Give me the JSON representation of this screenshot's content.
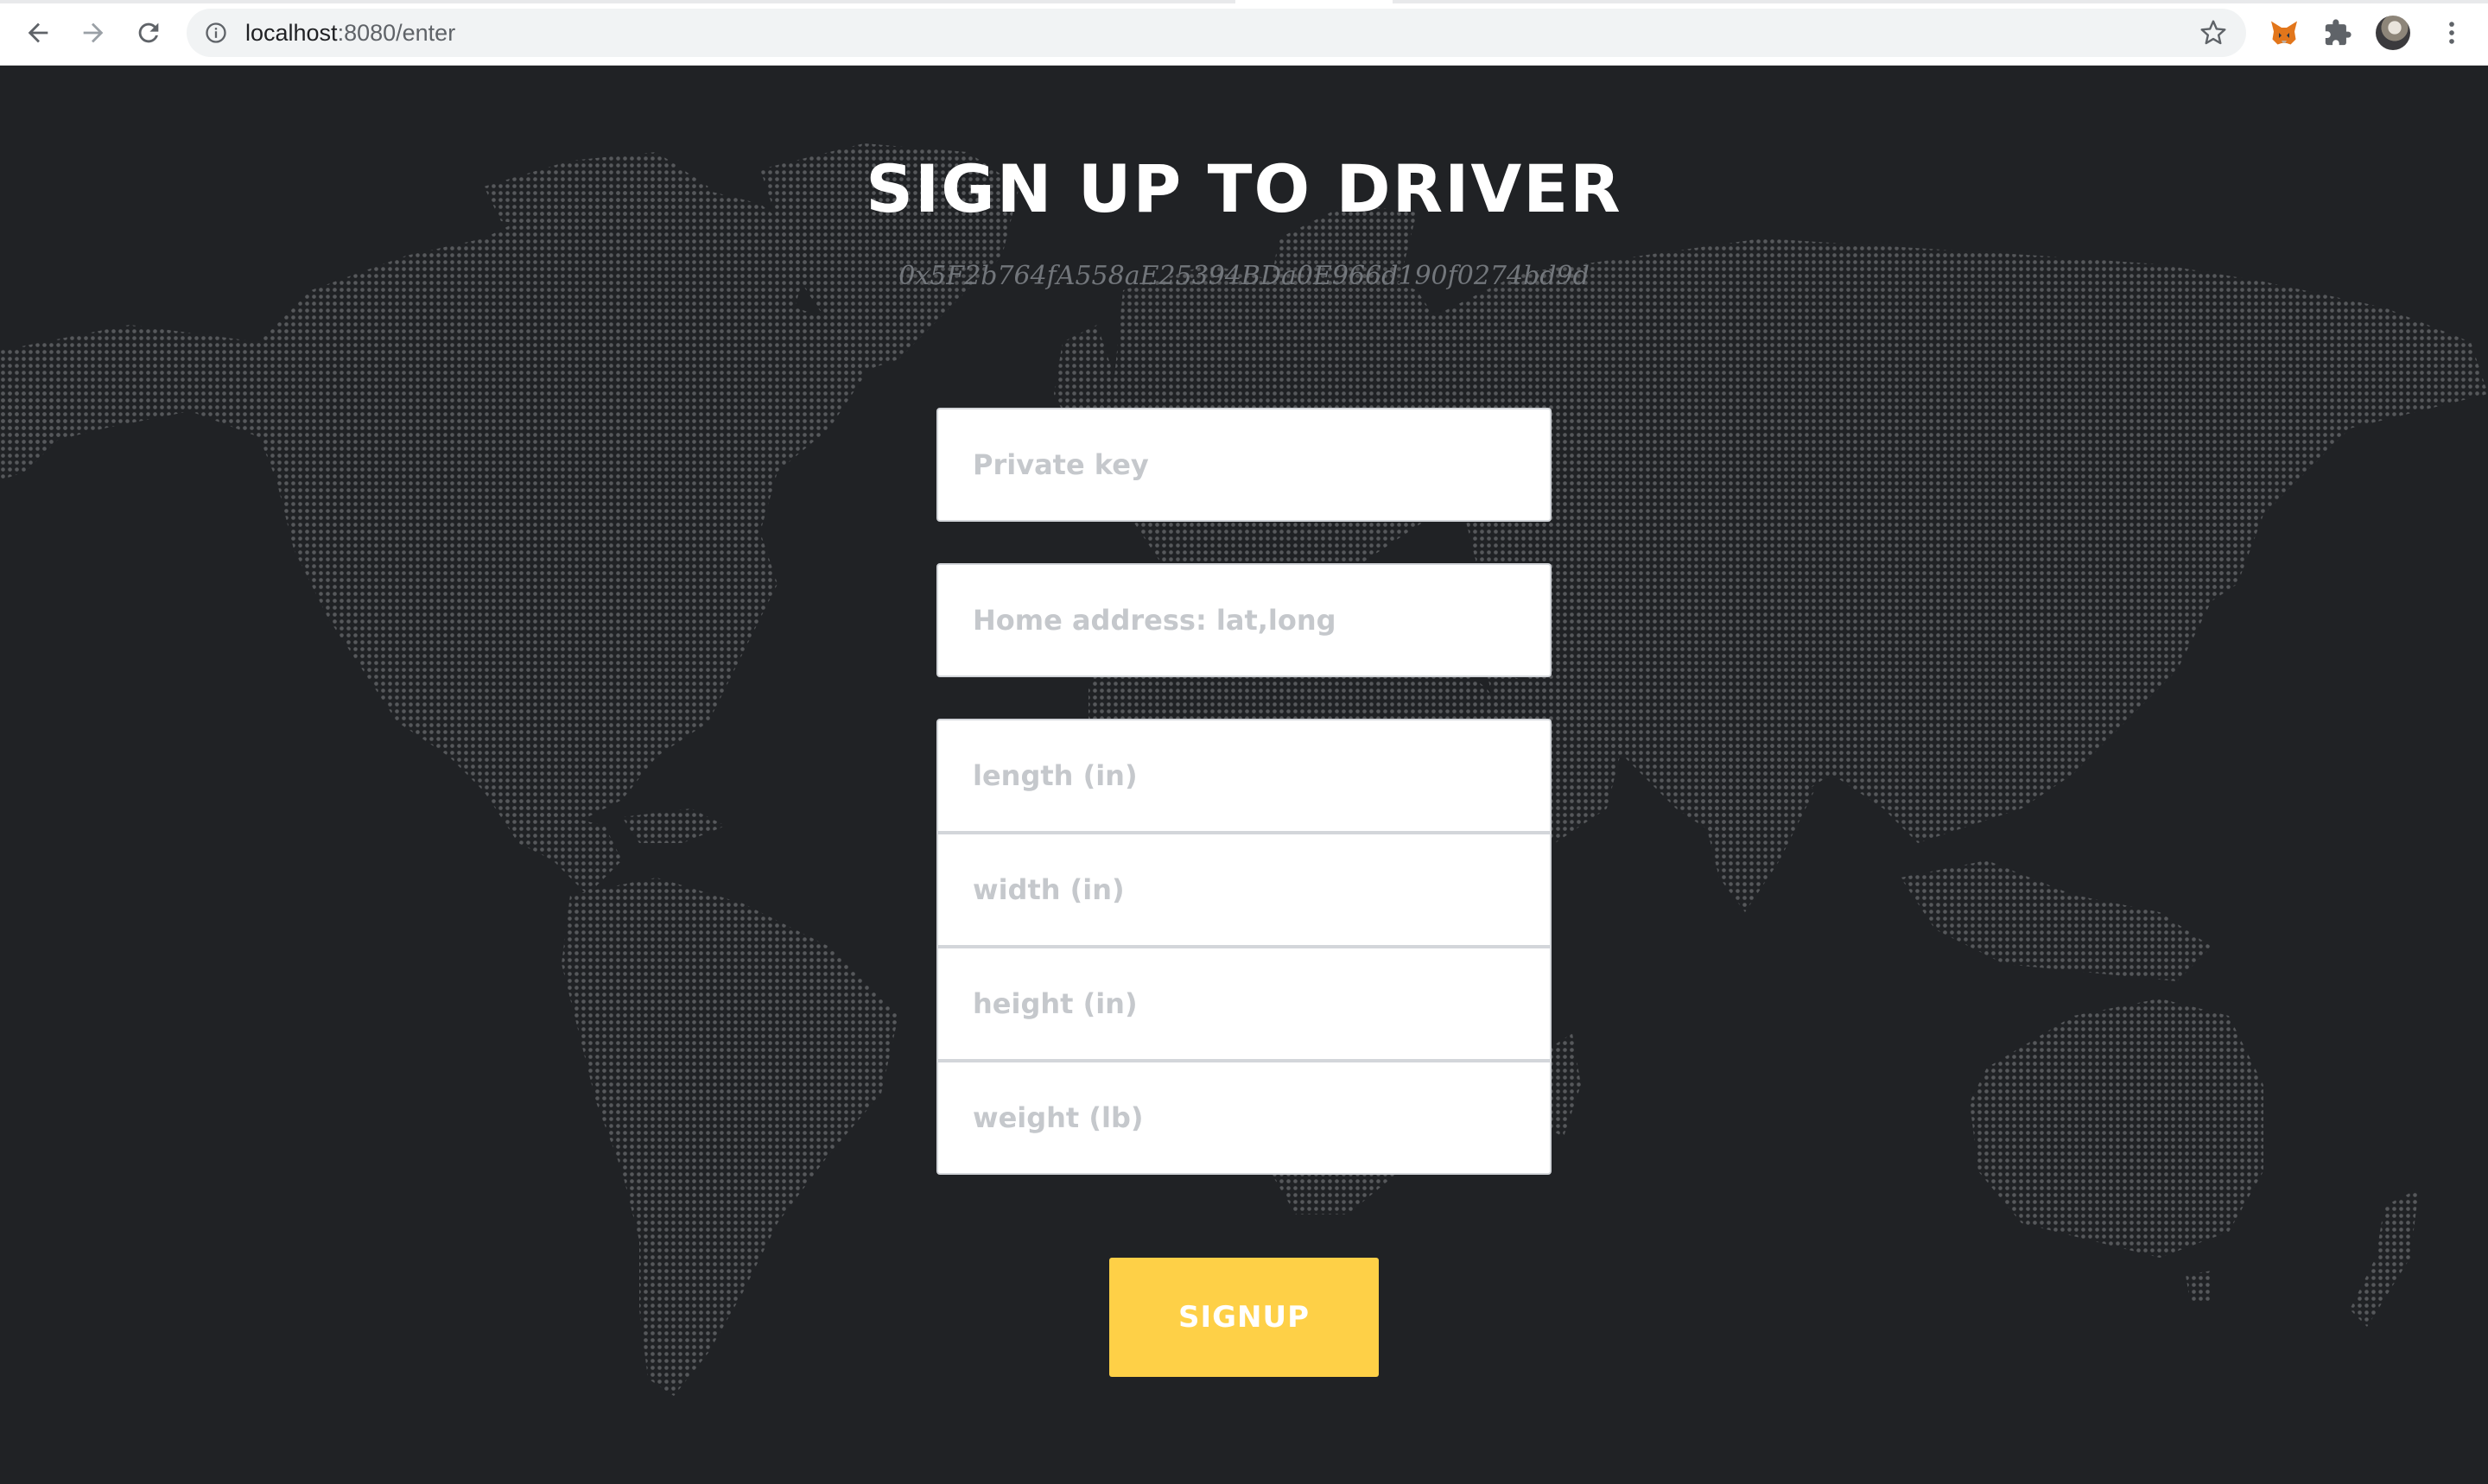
{
  "browser": {
    "url_host": "localhost",
    "url_path": ":8080/enter",
    "icons": [
      "back-arrow-icon",
      "forward-arrow-icon",
      "reload-icon",
      "info-icon",
      "star-icon",
      "metamask-fox-icon",
      "puzzle-icon",
      "avatar",
      "kebab-menu-icon"
    ]
  },
  "page": {
    "title": "SIGN UP TO DRIVER",
    "wallet_address": "0x5F2b764fA558aE25394BDa0E966d190f0274bd9d",
    "fields": {
      "private_key": {
        "placeholder": "Private key",
        "value": ""
      },
      "home_address": {
        "placeholder": "Home address: lat,long",
        "value": ""
      },
      "length": {
        "placeholder": "length (in)",
        "value": ""
      },
      "width": {
        "placeholder": "width (in)",
        "value": ""
      },
      "height": {
        "placeholder": "height (in)",
        "value": ""
      },
      "weight": {
        "placeholder": "weight (lb)",
        "value": ""
      }
    },
    "signup_label": "SIGNUP"
  },
  "colors": {
    "background": "#202225",
    "map_dots": "#5a5c5f",
    "button": "#fed047",
    "title": "#ffffff",
    "address": "#72767b"
  }
}
